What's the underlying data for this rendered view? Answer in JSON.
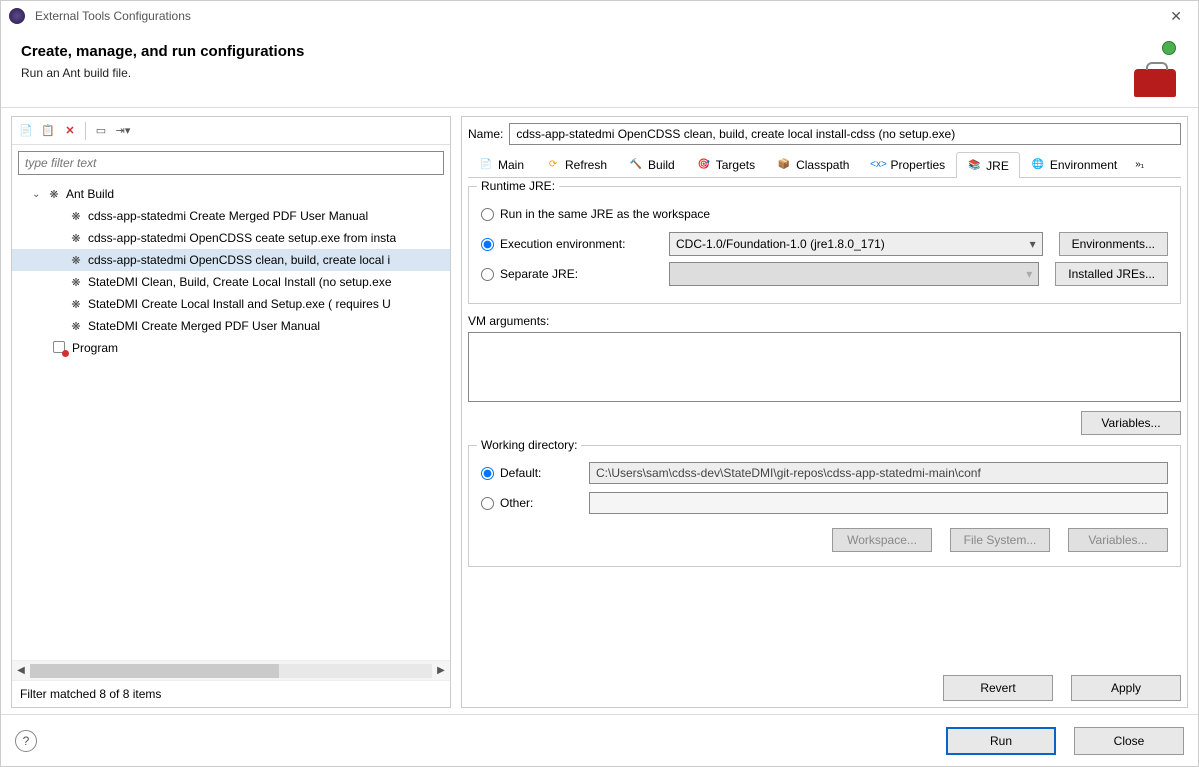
{
  "window": {
    "title": "External Tools Configurations"
  },
  "header": {
    "title": "Create, manage, and run configurations",
    "subtitle": "Run an Ant build file."
  },
  "left": {
    "filter_placeholder": "type filter text",
    "tree": {
      "root": "Ant Build",
      "items": [
        "cdss-app-statedmi Create Merged PDF User Manual",
        "cdss-app-statedmi OpenCDSS ceate setup.exe from insta",
        "cdss-app-statedmi OpenCDSS clean, build, create local i",
        "StateDMI Clean, Build, Create Local Install (no setup.exe ",
        "StateDMI Create Local Install and Setup.exe  ( requires U",
        "StateDMI Create Merged PDF User Manual"
      ],
      "selected_index": 2,
      "leaf2": "Program"
    },
    "status": "Filter matched 8 of 8 items"
  },
  "right": {
    "name_label": "Name:",
    "name_value": "cdss-app-statedmi OpenCDSS clean, build, create local install-cdss (no setup.exe)",
    "tabs": [
      {
        "label": "Main"
      },
      {
        "label": "Refresh"
      },
      {
        "label": "Build"
      },
      {
        "label": "Targets"
      },
      {
        "label": "Classpath"
      },
      {
        "label": "Properties"
      },
      {
        "label": "JRE",
        "active": true
      },
      {
        "label": "Environment"
      }
    ],
    "runtime": {
      "title": "Runtime JRE:",
      "opt1": "Run in the same JRE as the workspace",
      "opt2": "Execution environment:",
      "opt2_value": "CDC-1.0/Foundation-1.0 (jre1.8.0_171)",
      "opt2_btn": "Environments...",
      "opt3": "Separate JRE:",
      "opt3_btn": "Installed JREs..."
    },
    "vm": {
      "title": "VM arguments:",
      "btn": "Variables..."
    },
    "wd": {
      "title": "Working directory:",
      "default_label": "Default:",
      "default_value": "C:\\Users\\sam\\cdss-dev\\StateDMI\\git-repos\\cdss-app-statedmi-main\\conf",
      "other_label": "Other:",
      "btn1": "Workspace...",
      "btn2": "File System...",
      "btn3": "Variables..."
    },
    "revert": "Revert",
    "apply": "Apply"
  },
  "footer": {
    "run": "Run",
    "close": "Close"
  }
}
